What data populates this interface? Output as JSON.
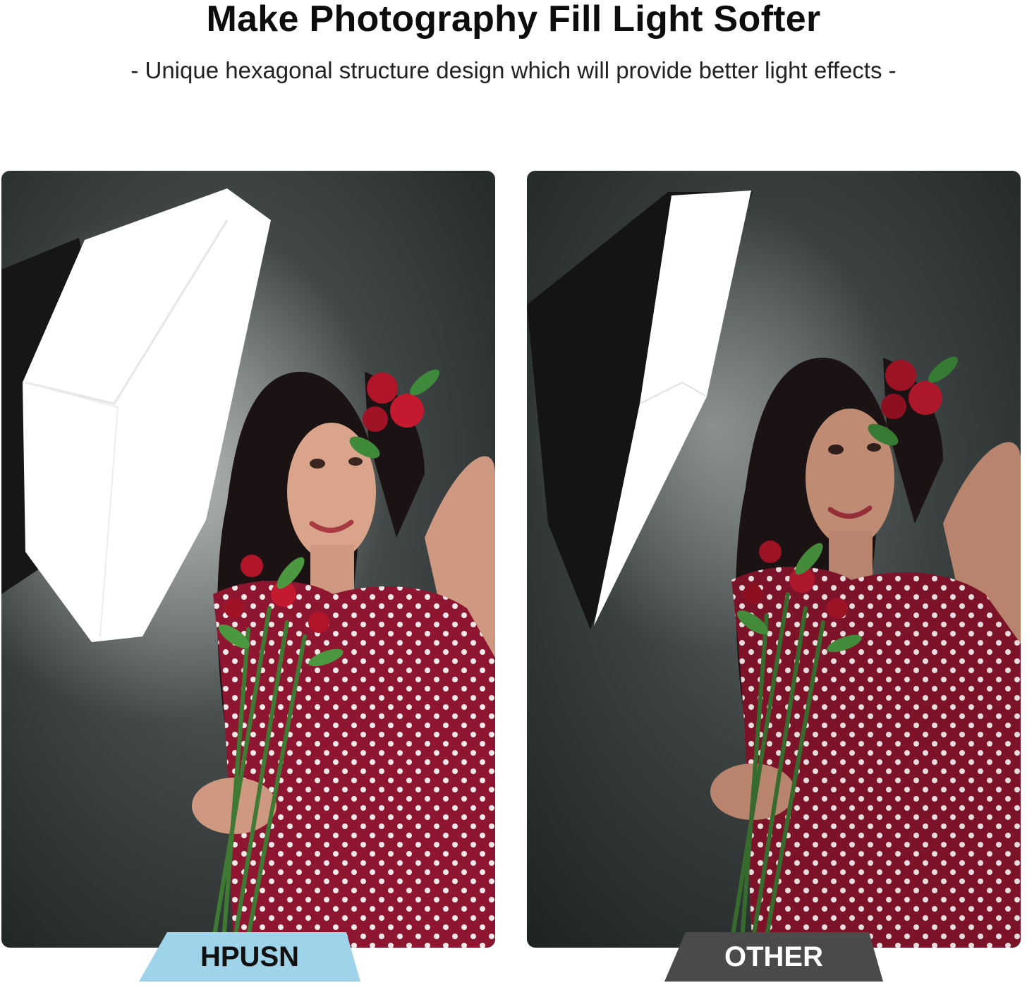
{
  "header": {
    "title": "Make Photography Fill Light Softer",
    "subtitle": "- Unique hexagonal structure design which will provide better light effects -"
  },
  "comparison": {
    "left": {
      "label": "HPUSN",
      "label_bg": "#9fd3ea",
      "label_color": "#111111",
      "softbox_shape": "octagonal"
    },
    "right": {
      "label": "OTHER",
      "label_bg": "#4a4a4a",
      "label_color": "#ffffff",
      "softbox_shape": "rectangular"
    }
  },
  "colors": {
    "backdrop": "#2e3536",
    "dress": "#8e1630",
    "softbox_front": "#ffffff",
    "softbox_body": "#1a1a1a"
  }
}
